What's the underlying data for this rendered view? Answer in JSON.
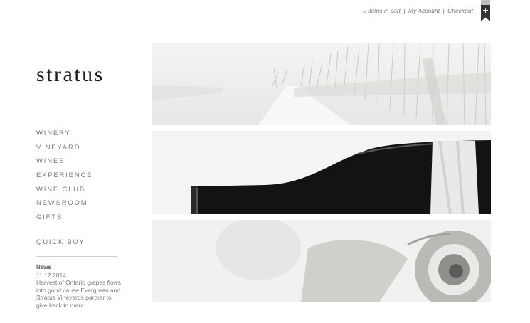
{
  "topbar": {
    "cart": "0 items in cart",
    "sep": "|",
    "account": "My Account",
    "checkout": "Checkout"
  },
  "bookmark": {
    "icon": "plus-icon",
    "glyph": "+"
  },
  "brand": {
    "logo": "stratus"
  },
  "nav": {
    "items": [
      "WINERY",
      "VINEYARD",
      "WINES",
      "EXPERIENCE",
      "WINE CLUB",
      "NEWSROOM",
      "GIFTS"
    ]
  },
  "quick_buy": "QUICK BUY",
  "news": {
    "title": "News",
    "date": "11.12.2014",
    "text": "Harvest of Ontario grapes flows into good cause Evergreen and Stratus Vineyards partner to give back to natur..."
  },
  "colors": {
    "logo": "#1d1d1d",
    "nav": "#7b7b7b",
    "bottle": "#141414"
  }
}
